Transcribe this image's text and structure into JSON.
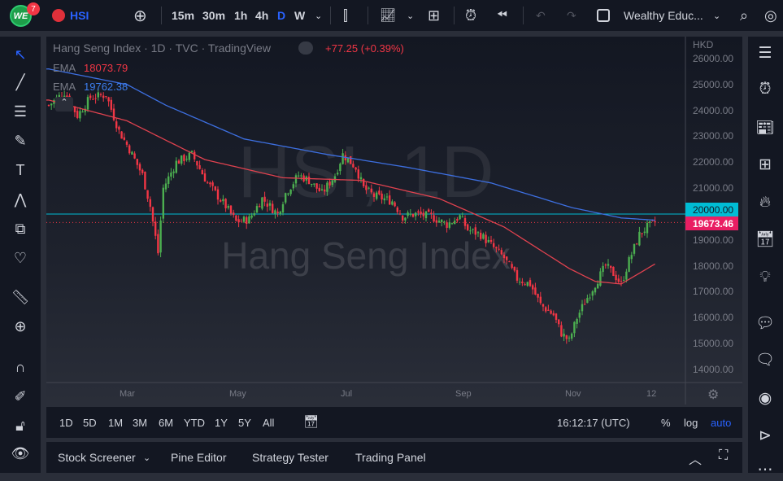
{
  "topbar": {
    "logo": "WE",
    "notifications": "7",
    "symbol": "HSI",
    "intervals": [
      "15m",
      "30m",
      "1h",
      "4h",
      "D",
      "W"
    ],
    "active_interval": "D",
    "account": "Wealthy Educ..."
  },
  "legend": {
    "title": "Hang Seng Index · 1D · TVC · TradingView",
    "change": "+77.25 (+0.39%)",
    "ema1_label": "EMA",
    "ema1_value": "18073.79",
    "ema2_label": "EMA",
    "ema2_value": "19762.38"
  },
  "watermark": {
    "line1": "HSI, 1D",
    "line2": "Hang Seng Index"
  },
  "price_axis": {
    "currency": "HKD",
    "ticks": [
      "26000.00",
      "25000.00",
      "24000.00",
      "23000.00",
      "22000.00",
      "21000.00",
      "19000.00",
      "18000.00",
      "17000.00",
      "16000.00",
      "15000.00",
      "14000.00"
    ],
    "line_label": "20000.00",
    "last_price": "19673.46"
  },
  "time_axis": {
    "labels": [
      "Mar",
      "May",
      "Jul",
      "Sep",
      "Nov",
      "12"
    ]
  },
  "range_bar": {
    "ranges": [
      "1D",
      "5D",
      "1M",
      "3M",
      "6M",
      "YTD",
      "1Y",
      "5Y",
      "All"
    ],
    "clock": "16:12:17 (UTC)",
    "percent": "%",
    "log": "log",
    "auto": "auto"
  },
  "bottom_panel": {
    "tabs": [
      "Stock Screener",
      "Pine Editor",
      "Strategy Tester",
      "Trading Panel"
    ]
  },
  "colors": {
    "up": "#26a69a",
    "up_candle": "#4caf50",
    "down": "#f23645",
    "ema_fast": "#e0424f",
    "ema_slow": "#3d6fe0",
    "hline": "#00bcd4"
  },
  "chart_data": {
    "type": "candlestick",
    "ylim": [
      14000,
      26500
    ],
    "hline": 20000,
    "last": 19673.46,
    "close_path": [
      [
        0,
        24200
      ],
      [
        6,
        24700
      ],
      [
        11,
        23800
      ],
      [
        16,
        24500
      ],
      [
        22,
        24600
      ],
      [
        27,
        23200
      ],
      [
        31,
        22500
      ],
      [
        36,
        21500
      ],
      [
        39,
        20300
      ],
      [
        42,
        18500
      ],
      [
        44,
        21000
      ],
      [
        49,
        22000
      ],
      [
        55,
        22300
      ],
      [
        61,
        21200
      ],
      [
        68,
        20300
      ],
      [
        72,
        19700
      ],
      [
        77,
        19800
      ],
      [
        82,
        20600
      ],
      [
        88,
        20000
      ],
      [
        91,
        20800
      ],
      [
        96,
        21500
      ],
      [
        100,
        21300
      ],
      [
        105,
        20800
      ],
      [
        110,
        21500
      ],
      [
        113,
        22300
      ],
      [
        118,
        21800
      ],
      [
        121,
        21000
      ],
      [
        125,
        20700
      ],
      [
        132,
        20500
      ],
      [
        136,
        19900
      ],
      [
        141,
        20000
      ],
      [
        147,
        19900
      ],
      [
        153,
        19600
      ],
      [
        158,
        19900
      ],
      [
        161,
        19400
      ],
      [
        166,
        19200
      ],
      [
        171,
        18700
      ],
      [
        175,
        18300
      ],
      [
        180,
        17500
      ],
      [
        185,
        17300
      ],
      [
        189,
        16500
      ],
      [
        194,
        16100
      ],
      [
        197,
        15400
      ],
      [
        200,
        15100
      ],
      [
        203,
        16000
      ],
      [
        206,
        16600
      ],
      [
        210,
        17300
      ],
      [
        214,
        18000
      ],
      [
        217,
        17700
      ],
      [
        220,
        17300
      ],
      [
        223,
        18200
      ],
      [
        227,
        19200
      ],
      [
        230,
        19500
      ],
      [
        233,
        19673
      ]
    ],
    "ema_fast": [
      [
        0,
        24400
      ],
      [
        30,
        23600
      ],
      [
        60,
        22100
      ],
      [
        90,
        21400
      ],
      [
        120,
        21300
      ],
      [
        150,
        20600
      ],
      [
        175,
        19500
      ],
      [
        200,
        17900
      ],
      [
        210,
        17400
      ],
      [
        220,
        17300
      ],
      [
        233,
        18074
      ]
    ],
    "ema_slow": [
      [
        0,
        25600
      ],
      [
        30,
        25000
      ],
      [
        45,
        24200
      ],
      [
        75,
        22900
      ],
      [
        107,
        22300
      ],
      [
        138,
        21800
      ],
      [
        170,
        21200
      ],
      [
        201,
        20250
      ],
      [
        220,
        19850
      ],
      [
        233,
        19762
      ]
    ]
  }
}
